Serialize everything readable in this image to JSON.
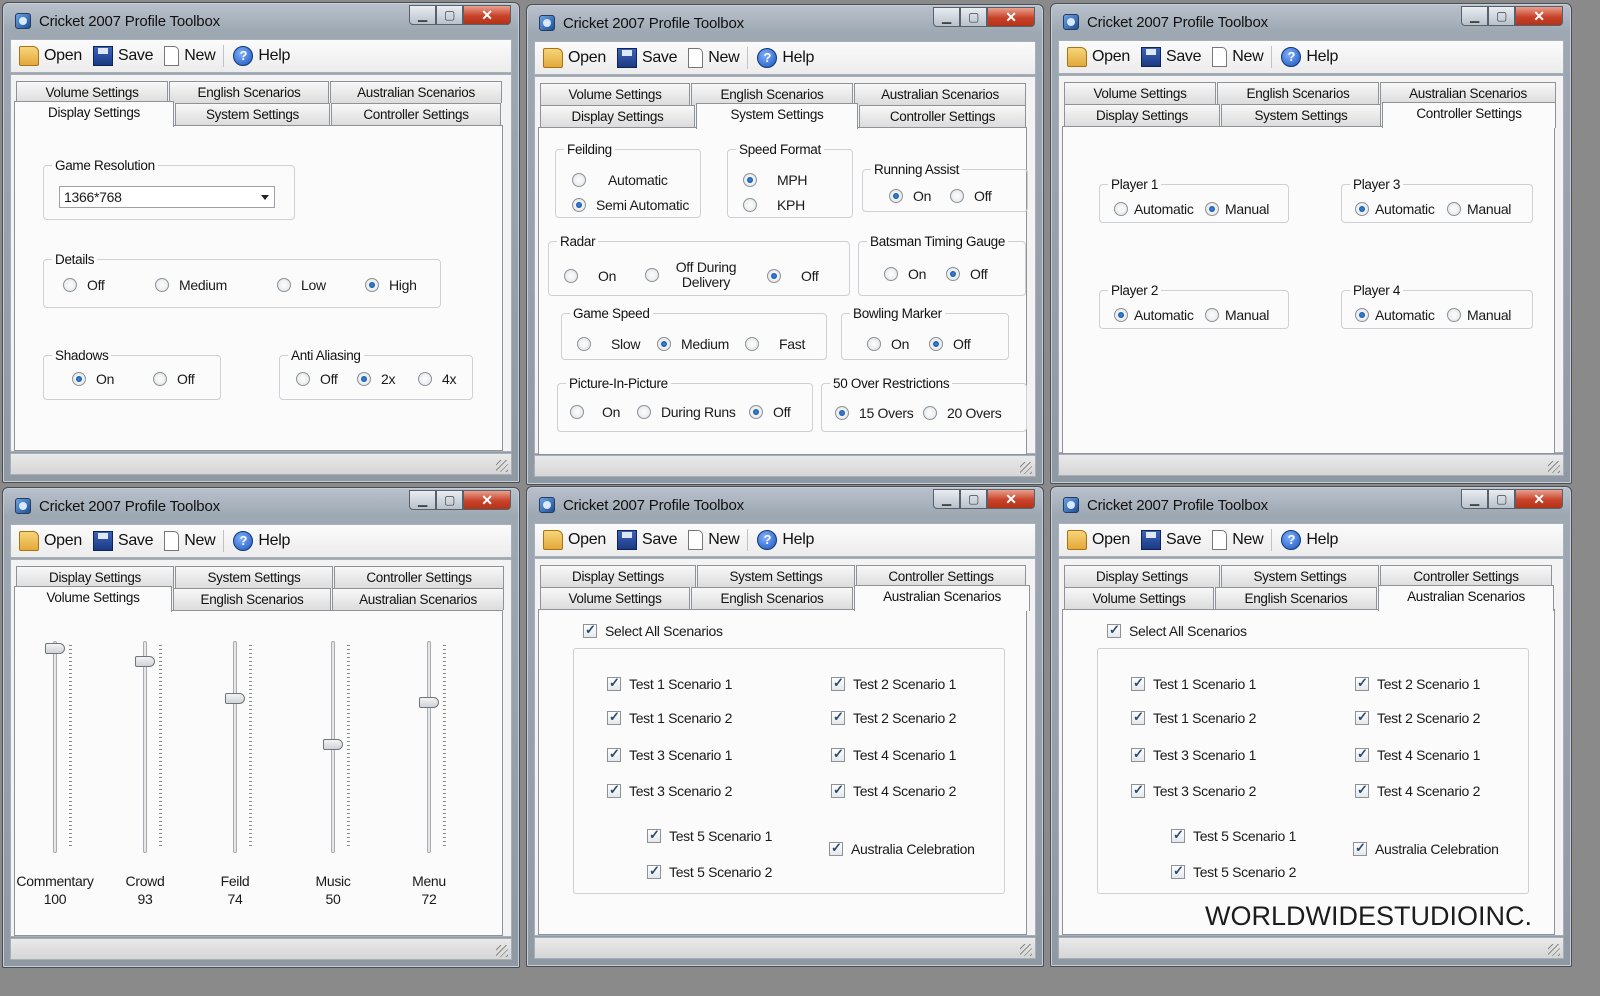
{
  "window_title": "Cricket 2007 Profile Toolbox",
  "toolbar": {
    "open": "Open",
    "save": "Save",
    "new": "New",
    "help": "Help"
  },
  "tabs": {
    "volume": "Volume Settings",
    "english": "English Scenarios",
    "australian": "Australian Scenarios",
    "display": "Display Settings",
    "system": "System Settings",
    "controller": "Controller Settings"
  },
  "display": {
    "resolution_label": "Game Resolution",
    "resolution_value": "1366*768",
    "details_label": "Details",
    "details_opts": [
      "Off",
      "Medium",
      "Low",
      "High"
    ],
    "details_selected": "High",
    "shadows_label": "Shadows",
    "shadows_opts": [
      "On",
      "Off"
    ],
    "shadows_selected": "On",
    "aa_label": "Anti Aliasing",
    "aa_opts": [
      "Off",
      "2x",
      "4x"
    ],
    "aa_selected": "2x"
  },
  "system": {
    "fielding_label": "Feilding",
    "fielding_opts": [
      "Automatic",
      "Semi Automatic"
    ],
    "fielding_selected": "Semi Automatic",
    "speed_label": "Speed Format",
    "speed_opts": [
      "MPH",
      "KPH"
    ],
    "speed_selected": "MPH",
    "running_label": "Running Assist",
    "running_opts": [
      "On",
      "Off"
    ],
    "running_selected": "On",
    "radar_label": "Radar",
    "radar_opts": [
      "On",
      "Off During Delivery",
      "Off"
    ],
    "radar_selected": "Off",
    "timing_label": "Batsman Timing Gauge",
    "timing_opts": [
      "On",
      "Off"
    ],
    "timing_selected": "Off",
    "gamespeed_label": "Game Speed",
    "gamespeed_opts": [
      "Slow",
      "Medium",
      "Fast"
    ],
    "gamespeed_selected": "Medium",
    "bowling_label": "Bowling Marker",
    "bowling_opts": [
      "On",
      "Off"
    ],
    "bowling_selected": "Off",
    "pip_label": "Picture-In-Picture",
    "pip_opts": [
      "On",
      "During Runs",
      "Off"
    ],
    "pip_selected": "Off",
    "overs_label": "50 Over Restrictions",
    "overs_opts": [
      "15 Overs",
      "20 Overs"
    ],
    "overs_selected": "15 Overs"
  },
  "controller": {
    "opts": [
      "Automatic",
      "Manual"
    ],
    "players": [
      {
        "label": "Player 1",
        "selected": "Manual"
      },
      {
        "label": "Player 3",
        "selected": "Automatic"
      },
      {
        "label": "Player 2",
        "selected": "Automatic"
      },
      {
        "label": "Player 4",
        "selected": "Automatic"
      }
    ]
  },
  "volume": {
    "sliders": [
      {
        "label": "Commentary",
        "value": "100"
      },
      {
        "label": "Crowd",
        "value": "93"
      },
      {
        "label": "Feild",
        "value": "74"
      },
      {
        "label": "Music",
        "value": "50"
      },
      {
        "label": "Menu",
        "value": "72"
      }
    ]
  },
  "scenarios": {
    "select_all": "Select All Scenarios",
    "col1": [
      "Test 1 Scenario 1",
      "Test 1 Scenario 2",
      "Test 3 Scenario 1",
      "Test 3 Scenario 2"
    ],
    "col2": [
      "Test 2 Scenario 1",
      "Test 2 Scenario 2",
      "Test 4 Scenario 1",
      "Test 4 Scenario 2"
    ],
    "bottom": [
      "Test 5 Scenario 1",
      "Test 5 Scenario 2"
    ],
    "celebration": "Australia Celebration"
  },
  "watermark": "WORLDWIDESTUDIOINC."
}
